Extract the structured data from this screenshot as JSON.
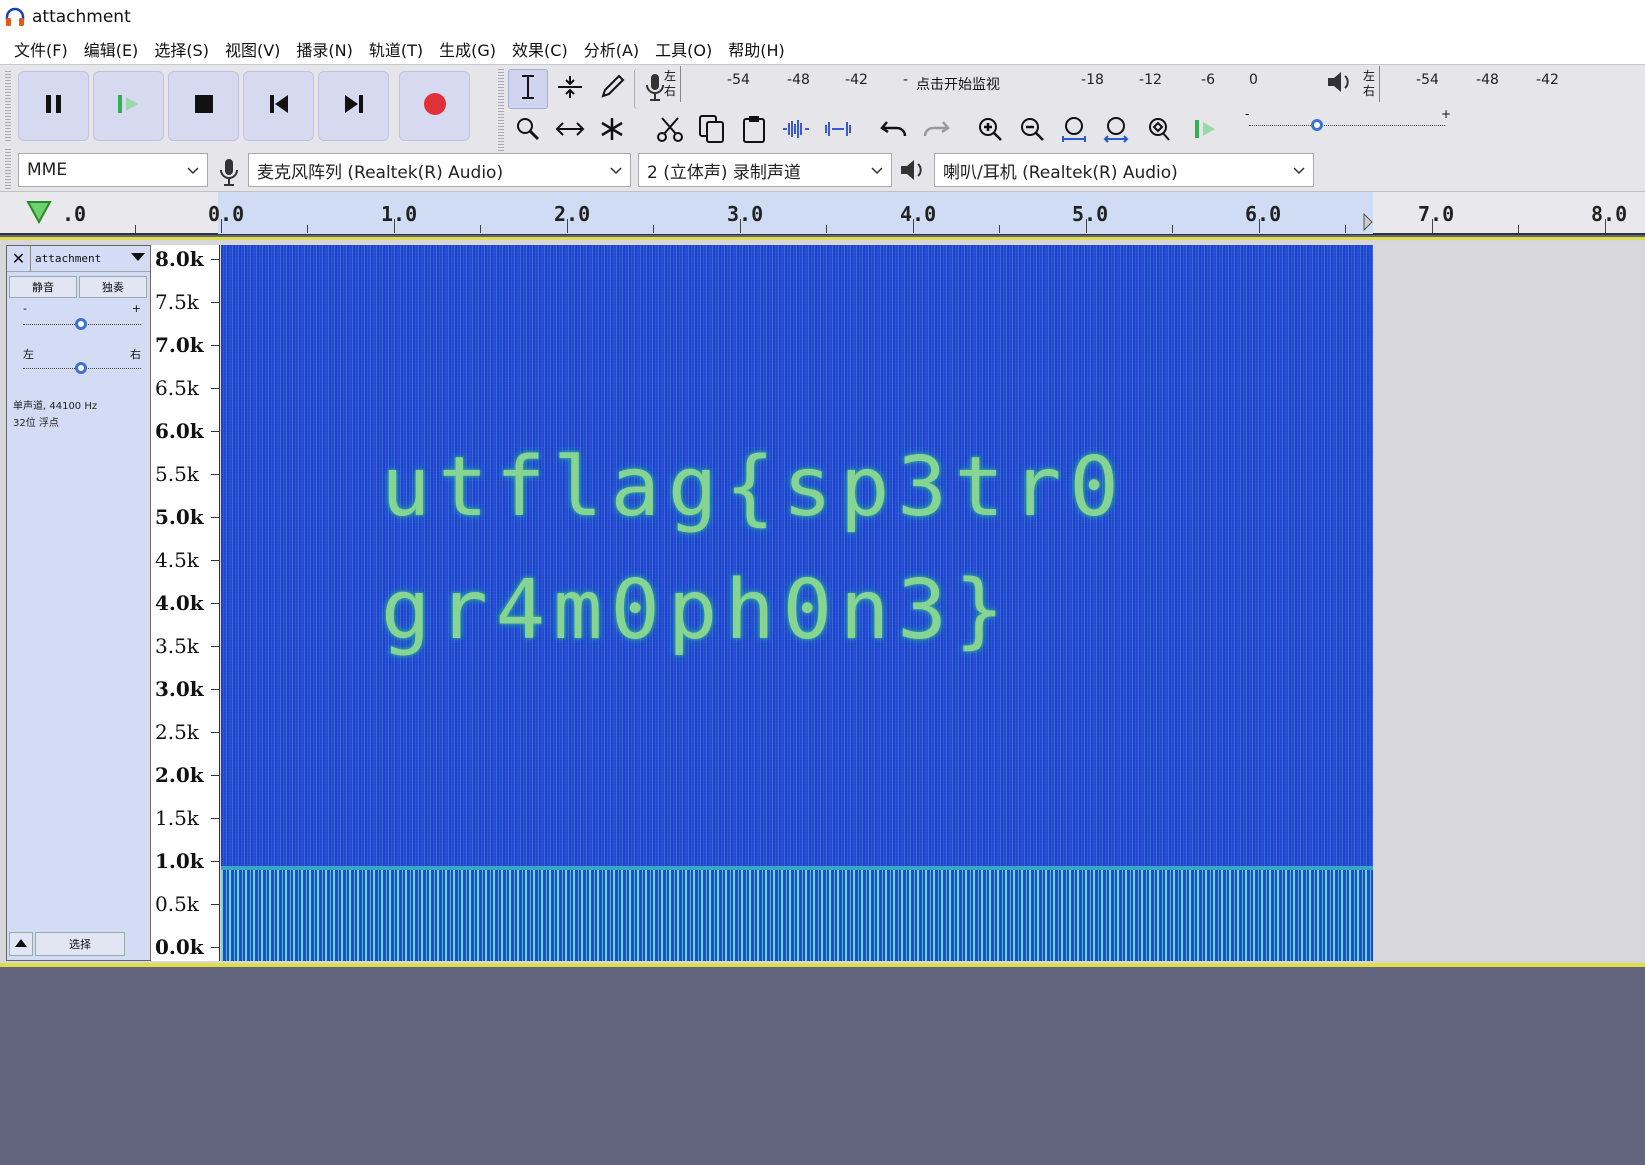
{
  "window": {
    "title": "attachment",
    "icon": "headphones-icon"
  },
  "menu": [
    "文件(F)",
    "编辑(E)",
    "选择(S)",
    "视图(V)",
    "播录(N)",
    "轨道(T)",
    "生成(G)",
    "效果(C)",
    "分析(A)",
    "工具(O)",
    "帮助(H)"
  ],
  "transport": [
    "pause-icon",
    "play-icon",
    "stop-icon",
    "skip-start-icon",
    "skip-end-icon",
    "record-icon"
  ],
  "record_meter": {
    "left": "左",
    "right": "右",
    "ticks": [
      "-54",
      "-48",
      "-42",
      "-",
      "-18",
      "-12",
      "-6",
      "0"
    ],
    "hint": "点击开始监视"
  },
  "play_meter": {
    "left": "左",
    "right": "右",
    "ticks": [
      "-54",
      "-48",
      "-42"
    ]
  },
  "play_speed": {
    "minus": "-",
    "plus": "+"
  },
  "devices": {
    "host": "MME",
    "input": "麦克风阵列 (Realtek(R) Audio)",
    "channels": "2 (立体声) 录制声道",
    "output": "喇叭/耳机 (Realtek(R) Audio)"
  },
  "ruler": {
    "labels": [
      ".0",
      "0.0",
      "1.0",
      "2.0",
      "3.0",
      "4.0",
      "5.0",
      "6.0",
      "7.0",
      "8.0"
    ]
  },
  "track": {
    "name": "attachment",
    "mute": "静音",
    "solo": "独奏",
    "gain_minus": "-",
    "gain_plus": "+",
    "pan_left": "左",
    "pan_right": "右",
    "info_line1": "单声道, 44100 Hz",
    "info_line2": "32位 浮点",
    "select": "选择"
  },
  "freq_labels": [
    "8.0k",
    "7.5k",
    "7.0k",
    "6.5k",
    "6.0k",
    "5.5k",
    "5.0k",
    "4.5k",
    "4.0k",
    "3.5k",
    "3.0k",
    "2.5k",
    "2.0k",
    "1.5k",
    "1.0k",
    "0.5k",
    "0.0k"
  ],
  "spectrogram": {
    "line1": "utflag{sp3tr0",
    "line2": "gr4m0ph0n3}"
  },
  "colors": {
    "accent": "#3a74d0",
    "track_border": "#dede4a",
    "spectrogram_bg": "#1f44d0",
    "text_glow": "#8fe08f"
  }
}
